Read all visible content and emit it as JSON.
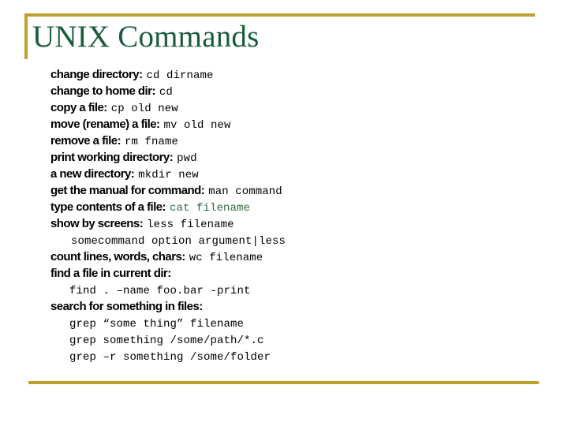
{
  "slide": {
    "title": "UNIX Commands",
    "title_color": "#1a5c3a",
    "accent_color": "#bfa02e",
    "background_color": "#ffffff",
    "command_highlight_color": "#2f6b3f"
  },
  "lines": [
    {
      "desc": "change directory:",
      "cmd": "cd dirname",
      "indent": "none",
      "cmd_color": "black"
    },
    {
      "desc": "change to home dir:",
      "cmd": "cd",
      "indent": "none",
      "cmd_color": "black"
    },
    {
      "desc": "copy a file:",
      "cmd": "cp old new",
      "indent": "none",
      "cmd_color": "black"
    },
    {
      "desc": "move (rename) a file:",
      "cmd": "mv old new",
      "indent": "none",
      "cmd_color": "black"
    },
    {
      "desc": "remove a file:",
      "cmd": "rm fname",
      "indent": "none",
      "cmd_color": "black"
    },
    {
      "desc": "print working directory:",
      "cmd": "pwd",
      "indent": "none",
      "cmd_color": "black"
    },
    {
      "desc": "a new directory:",
      "cmd": "mkdir new",
      "indent": "none",
      "cmd_color": "black"
    },
    {
      "desc": "get the manual for command:",
      "cmd": "man command",
      "indent": "none",
      "cmd_color": "black"
    },
    {
      "desc": "type contents of a file:",
      "cmd": "cat filename",
      "indent": "none",
      "cmd_color": "green"
    },
    {
      "desc": "show by screens:",
      "cmd": "less filename",
      "indent": "none",
      "cmd_color": "black"
    },
    {
      "desc": "",
      "cmd": "somecommand option argument|less",
      "indent": "deep",
      "cmd_color": "black"
    },
    {
      "desc": "count lines, words, chars:",
      "cmd": "wc filename",
      "indent": "none",
      "cmd_color": "black"
    },
    {
      "desc": "find a file in current dir:",
      "cmd": "",
      "indent": "none",
      "cmd_color": "black"
    },
    {
      "desc": "",
      "cmd": "find . –name foo.bar -print",
      "indent": "sub",
      "cmd_color": "black"
    },
    {
      "desc": "search for something in files:",
      "cmd": "",
      "indent": "none",
      "cmd_color": "black"
    },
    {
      "desc": "",
      "cmd": "grep “some thing” filename",
      "indent": "sub",
      "cmd_color": "black"
    },
    {
      "desc": "",
      "cmd": "grep something /some/path/*.c",
      "indent": "sub",
      "cmd_color": "black"
    },
    {
      "desc": "",
      "cmd": "grep –r something /some/folder",
      "indent": "sub",
      "cmd_color": "black"
    }
  ]
}
